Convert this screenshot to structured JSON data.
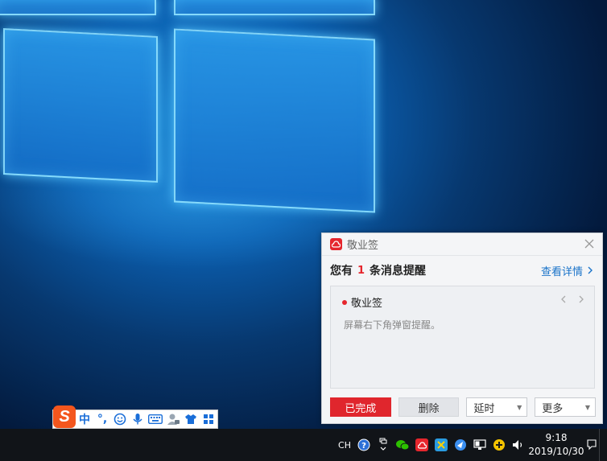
{
  "notification": {
    "app_name": "敬业签",
    "summary_prefix": "您有",
    "summary_count": "1",
    "summary_suffix": "条消息提醒",
    "view_details": "查看详情",
    "item_title": "敬业签",
    "item_body": "屏幕右下角弹窗提醒。",
    "buttons": {
      "done": "已完成",
      "delete": "删除",
      "delay": "延时",
      "more": "更多"
    },
    "accent_color": "#e5262d",
    "link_color": "#1a73c9"
  },
  "ime_toolbar": {
    "logo": "S",
    "mode": "中",
    "punctuation": "°,",
    "icons": [
      "smiley-icon",
      "microphone-icon",
      "keyboard-icon",
      "user-tools-icon",
      "skin-shirt-icon",
      "grid-menu-icon"
    ]
  },
  "taskbar": {
    "language": "CH",
    "time": "9:18",
    "date": "2019/10/30",
    "tray_icons": [
      "help-icon",
      "expand-tray-icon",
      "wechat-icon",
      "jingyeqian-icon",
      "app-icon",
      "browser-icon",
      "network-icon",
      "add-icon",
      "volume-icon"
    ]
  }
}
